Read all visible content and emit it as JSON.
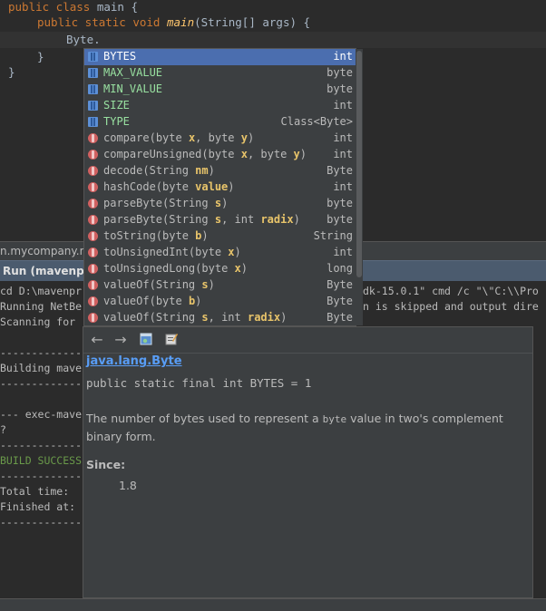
{
  "editor": {
    "lines": [
      {
        "kw": "public class",
        "rest": " main {"
      },
      {
        "kw": "public static void",
        "fn": "main",
        "rest": "(String[] args) {"
      },
      {
        "text": "Byte."
      },
      {
        "text": "}"
      },
      {
        "text": "}"
      }
    ]
  },
  "completion": {
    "items": [
      {
        "name": "BYTES",
        "type": "int",
        "kind": "field-icon",
        "selected": true
      },
      {
        "name": "MAX_VALUE",
        "type": "byte",
        "kind": "field-icon"
      },
      {
        "name": "MIN_VALUE",
        "type": "byte",
        "kind": "field-icon"
      },
      {
        "name": "SIZE",
        "type": "int",
        "kind": "field-icon"
      },
      {
        "name": "TYPE",
        "type": "Class<Byte>",
        "kind": "field-icon"
      },
      {
        "name": "compare",
        "params": [
          [
            "byte ",
            "x"
          ],
          [
            "byte ",
            "y"
          ]
        ],
        "type": "int",
        "kind": "method-icon"
      },
      {
        "name": "compareUnsigned",
        "params": [
          [
            "byte ",
            "x"
          ],
          [
            "byte ",
            "y"
          ]
        ],
        "type": "int",
        "kind": "method-icon"
      },
      {
        "name": "decode",
        "params": [
          [
            "String ",
            "nm"
          ]
        ],
        "type": "Byte",
        "kind": "method-icon"
      },
      {
        "name": "hashCode",
        "params": [
          [
            "byte ",
            "value"
          ]
        ],
        "type": "int",
        "kind": "method-icon"
      },
      {
        "name": "parseByte",
        "params": [
          [
            "String ",
            "s"
          ]
        ],
        "type": "byte",
        "kind": "method-icon"
      },
      {
        "name": "parseByte",
        "params": [
          [
            "String ",
            "s"
          ],
          [
            "int ",
            "radix"
          ]
        ],
        "type": "byte",
        "kind": "method-icon"
      },
      {
        "name": "toString",
        "params": [
          [
            "byte ",
            "b"
          ]
        ],
        "type": "String",
        "kind": "method-icon"
      },
      {
        "name": "toUnsignedInt",
        "params": [
          [
            "byte ",
            "x"
          ]
        ],
        "type": "int",
        "kind": "method-icon"
      },
      {
        "name": "toUnsignedLong",
        "params": [
          [
            "byte ",
            "x"
          ]
        ],
        "type": "long",
        "kind": "method-icon"
      },
      {
        "name": "valueOf",
        "params": [
          [
            "String ",
            "s"
          ]
        ],
        "type": "Byte",
        "kind": "method-icon"
      },
      {
        "name": "valueOf",
        "params": [
          [
            "byte ",
            "b"
          ]
        ],
        "type": "Byte",
        "kind": "method-icon"
      },
      {
        "name": "valueOf",
        "params": [
          [
            "String ",
            "s"
          ],
          [
            "int ",
            "radix"
          ]
        ],
        "type": "Byte",
        "kind": "method-icon"
      }
    ]
  },
  "filebar": {
    "label": "n.mycompany.ma"
  },
  "run": {
    "title": "Run (mavenpr"
  },
  "output": {
    "lines": [
      {
        "left": "cd D:\\mavenpr",
        "right": "dk-15.0.1\" cmd /c \"\\\"C:\\\\Pro"
      },
      {
        "left": "Running NetBe",
        "right": "n is skipped and output dire"
      },
      {
        "left": "Scanning for",
        "right": ""
      },
      {
        "left": "",
        "right": ""
      },
      {
        "left": "-------------",
        "right": ""
      },
      {
        "left": "Building mave",
        "right": ""
      },
      {
        "left": "-------------",
        "right": ""
      },
      {
        "left": "",
        "right": ""
      },
      {
        "left": "--- exec-mave",
        "right": ""
      },
      {
        "left": "?",
        "right": ""
      },
      {
        "left": "-------------",
        "right": ""
      },
      {
        "left": "BUILD SUCCESS",
        "right": "",
        "green": true
      },
      {
        "left": "-------------",
        "right": ""
      },
      {
        "left": "Total time:",
        "right": ""
      },
      {
        "left": "Finished at:",
        "right": ""
      },
      {
        "left": "-------------",
        "right": ""
      }
    ]
  },
  "javadoc": {
    "class_link": "java.lang.Byte",
    "signature": "public static final int BYTES = 1",
    "desc_before": "The number of bytes used to represent a ",
    "desc_code": "byte",
    "desc_after": " value in two's complement binary form.",
    "since_label": "Since:",
    "since_value": "1.8",
    "toolbar": {
      "back": "←",
      "forward": "→"
    }
  },
  "colors": {
    "selection": "#4b6eaf",
    "keyword": "#cc7832",
    "method": "#ffc66d",
    "link": "#589df6",
    "field_name": "#98e0a0",
    "param_name": "#e8c46a",
    "success": "#6a9a4a"
  }
}
